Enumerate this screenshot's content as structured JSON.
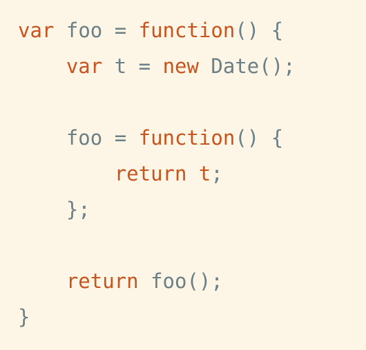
{
  "colors": {
    "background": "#fdf5e5",
    "keyword": "#c8541e",
    "identifier": "#6a7f86"
  },
  "code": {
    "lines": [
      {
        "tokens": [
          {
            "t": "var",
            "k": "kw"
          },
          {
            "t": " ",
            "k": "pn"
          },
          {
            "t": "foo",
            "k": "id"
          },
          {
            "t": " = ",
            "k": "pn"
          },
          {
            "t": "function",
            "k": "kw"
          },
          {
            "t": "() {",
            "k": "pn"
          }
        ]
      },
      {
        "tokens": [
          {
            "t": "    ",
            "k": "pn"
          },
          {
            "t": "var",
            "k": "kw"
          },
          {
            "t": " ",
            "k": "pn"
          },
          {
            "t": "t",
            "k": "id"
          },
          {
            "t": " = ",
            "k": "pn"
          },
          {
            "t": "new",
            "k": "kw"
          },
          {
            "t": " ",
            "k": "pn"
          },
          {
            "t": "Date",
            "k": "id"
          },
          {
            "t": "();",
            "k": "pn"
          }
        ]
      },
      {
        "tokens": []
      },
      {
        "tokens": [
          {
            "t": "    ",
            "k": "pn"
          },
          {
            "t": "foo",
            "k": "id"
          },
          {
            "t": " = ",
            "k": "pn"
          },
          {
            "t": "function",
            "k": "kw"
          },
          {
            "t": "() {",
            "k": "pn"
          }
        ]
      },
      {
        "tokens": [
          {
            "t": "        ",
            "k": "pn"
          },
          {
            "t": "return",
            "k": "kw"
          },
          {
            "t": " ",
            "k": "pn"
          },
          {
            "t": "t",
            "k": "kw"
          },
          {
            "t": ";",
            "k": "pn"
          }
        ]
      },
      {
        "tokens": [
          {
            "t": "    ",
            "k": "pn"
          },
          {
            "t": "};",
            "k": "pn"
          }
        ]
      },
      {
        "tokens": []
      },
      {
        "tokens": [
          {
            "t": "    ",
            "k": "pn"
          },
          {
            "t": "return",
            "k": "kw"
          },
          {
            "t": " ",
            "k": "pn"
          },
          {
            "t": "foo",
            "k": "id"
          },
          {
            "t": "();",
            "k": "pn"
          }
        ]
      },
      {
        "tokens": [
          {
            "t": "}",
            "k": "pn"
          }
        ]
      }
    ]
  }
}
